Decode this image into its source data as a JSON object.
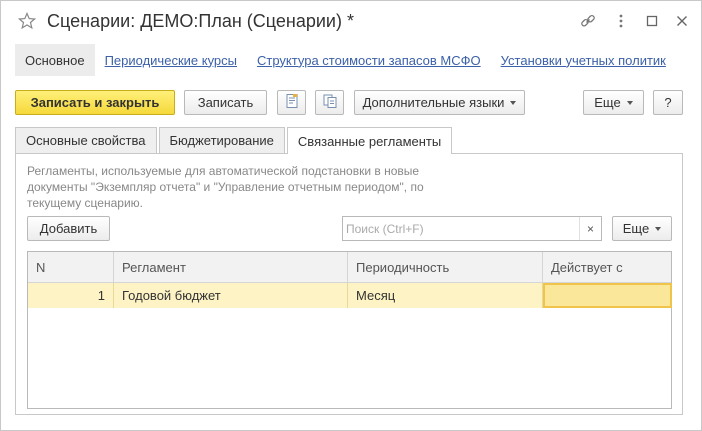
{
  "window": {
    "title": "Сценарии: ДЕМО:План (Сценарии) *"
  },
  "nav": {
    "items": [
      {
        "label": "Основное",
        "active": true
      },
      {
        "label": "Периодические курсы",
        "active": false
      },
      {
        "label": "Структура стоимости запасов МСФО",
        "active": false
      },
      {
        "label": "Установки учетных политик",
        "active": false
      }
    ]
  },
  "toolbar": {
    "save_close_label": "Записать и закрыть",
    "save_label": "Записать",
    "extra_languages_label": "Дополнительные языки",
    "more_label": "Еще",
    "help_label": "?"
  },
  "tabs": [
    {
      "label": "Основные свойства",
      "active": false
    },
    {
      "label": "Бюджетирование",
      "active": false
    },
    {
      "label": "Связанные регламенты",
      "active": true
    }
  ],
  "panel": {
    "description": "Регламенты, используемые для автоматической подстановки в новые документы \"Экземпляр отчета\" и \"Управление отчетным периодом\", по текущему сценарию.",
    "add_label": "Добавить",
    "search_placeholder": "Поиск (Ctrl+F)",
    "search_clear": "×",
    "more_label": "Еще"
  },
  "table": {
    "columns": [
      "N",
      "Регламент",
      "Периодичность",
      "Действует с"
    ],
    "rows": [
      {
        "n": "1",
        "reglament": "Годовой бюджет",
        "periodicity": "Месяц",
        "valid_from": ""
      }
    ]
  },
  "colors": {
    "primary_button": "#f5d93a",
    "link": "#3c61a8",
    "row_highlight": "#fdf3c5"
  }
}
